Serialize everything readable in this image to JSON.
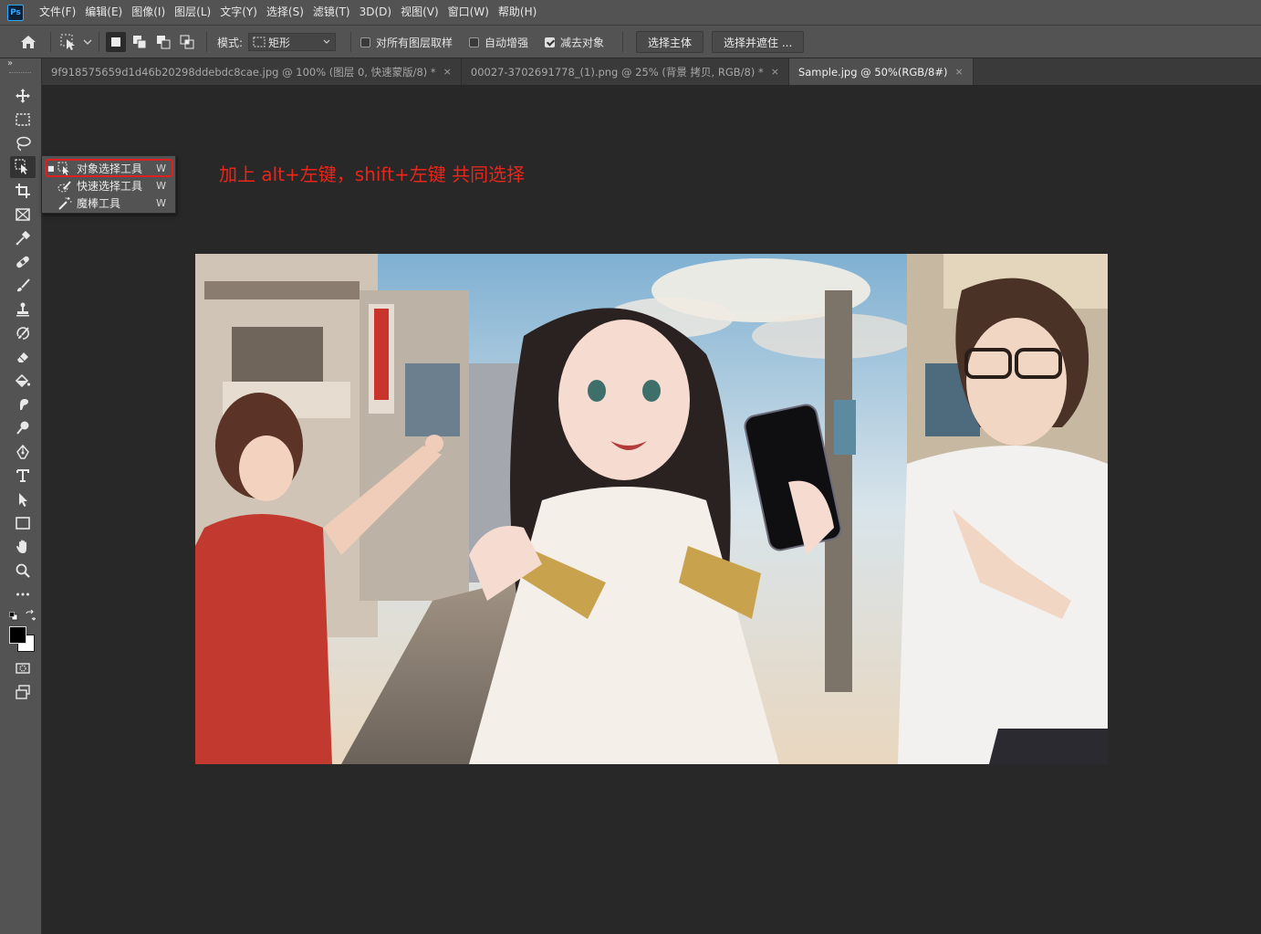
{
  "app": {
    "logo": "Ps"
  },
  "menu": {
    "items": [
      "文件(F)",
      "编辑(E)",
      "图像(I)",
      "图层(L)",
      "文字(Y)",
      "选择(S)",
      "滤镜(T)",
      "3D(D)",
      "视图(V)",
      "窗口(W)",
      "帮助(H)"
    ]
  },
  "options": {
    "home_icon": "home-icon",
    "tool_icon": "object-selection-icon",
    "mode_label": "模式:",
    "mode_value": "矩形",
    "sample_all_layers": {
      "label": "对所有图层取样",
      "checked": false
    },
    "auto_enhance": {
      "label": "自动增强",
      "checked": false
    },
    "subtract_object": {
      "label": "减去对象",
      "checked": true
    },
    "select_subject": "选择主体",
    "select_and_mask": "选择并遮住 ..."
  },
  "tabs": [
    {
      "title": "9f918575659d1d46b20298ddebdc8cae.jpg @ 100% (图层 0, 快速蒙版/8) *",
      "close": "×",
      "active": false
    },
    {
      "title": "00027-3702691778_(1).png @ 25% (背景 拷贝, RGB/8) *",
      "close": "×",
      "active": false
    },
    {
      "title": "Sample.jpg @ 50%(RGB/8#)",
      "close": "×",
      "active": true
    }
  ],
  "toolbar": {
    "collapse": "»",
    "tools": [
      "move-icon",
      "marquee-icon",
      "lasso-icon",
      "object-selection-icon",
      "crop-icon",
      "frame-icon",
      "eyedropper-icon",
      "healing-brush-icon",
      "brush-icon",
      "clone-stamp-icon",
      "history-brush-icon",
      "eraser-icon",
      "paint-bucket-icon",
      "smudge-icon",
      "dodge-icon",
      "pen-icon",
      "type-icon",
      "path-selection-icon",
      "rectangle-icon",
      "hand-icon",
      "zoom-icon",
      "more-tools-icon"
    ],
    "foreground_color": "#000000",
    "background_color": "#ffffff"
  },
  "flyout": {
    "items": [
      {
        "label": "对象选择工具",
        "shortcut": "W",
        "icon": "object-selection-icon",
        "selected": true
      },
      {
        "label": "快速选择工具",
        "shortcut": "W",
        "icon": "quick-selection-icon",
        "selected": false
      },
      {
        "label": "魔棒工具",
        "shortcut": "W",
        "icon": "magic-wand-icon",
        "selected": false
      }
    ]
  },
  "annotation": {
    "text": "加上 alt+左键，shift+左键 共同选择",
    "color": "#e8261a"
  },
  "colors": {
    "chrome": "#535353",
    "workspace": "#282828",
    "accent_red": "#e02020"
  }
}
